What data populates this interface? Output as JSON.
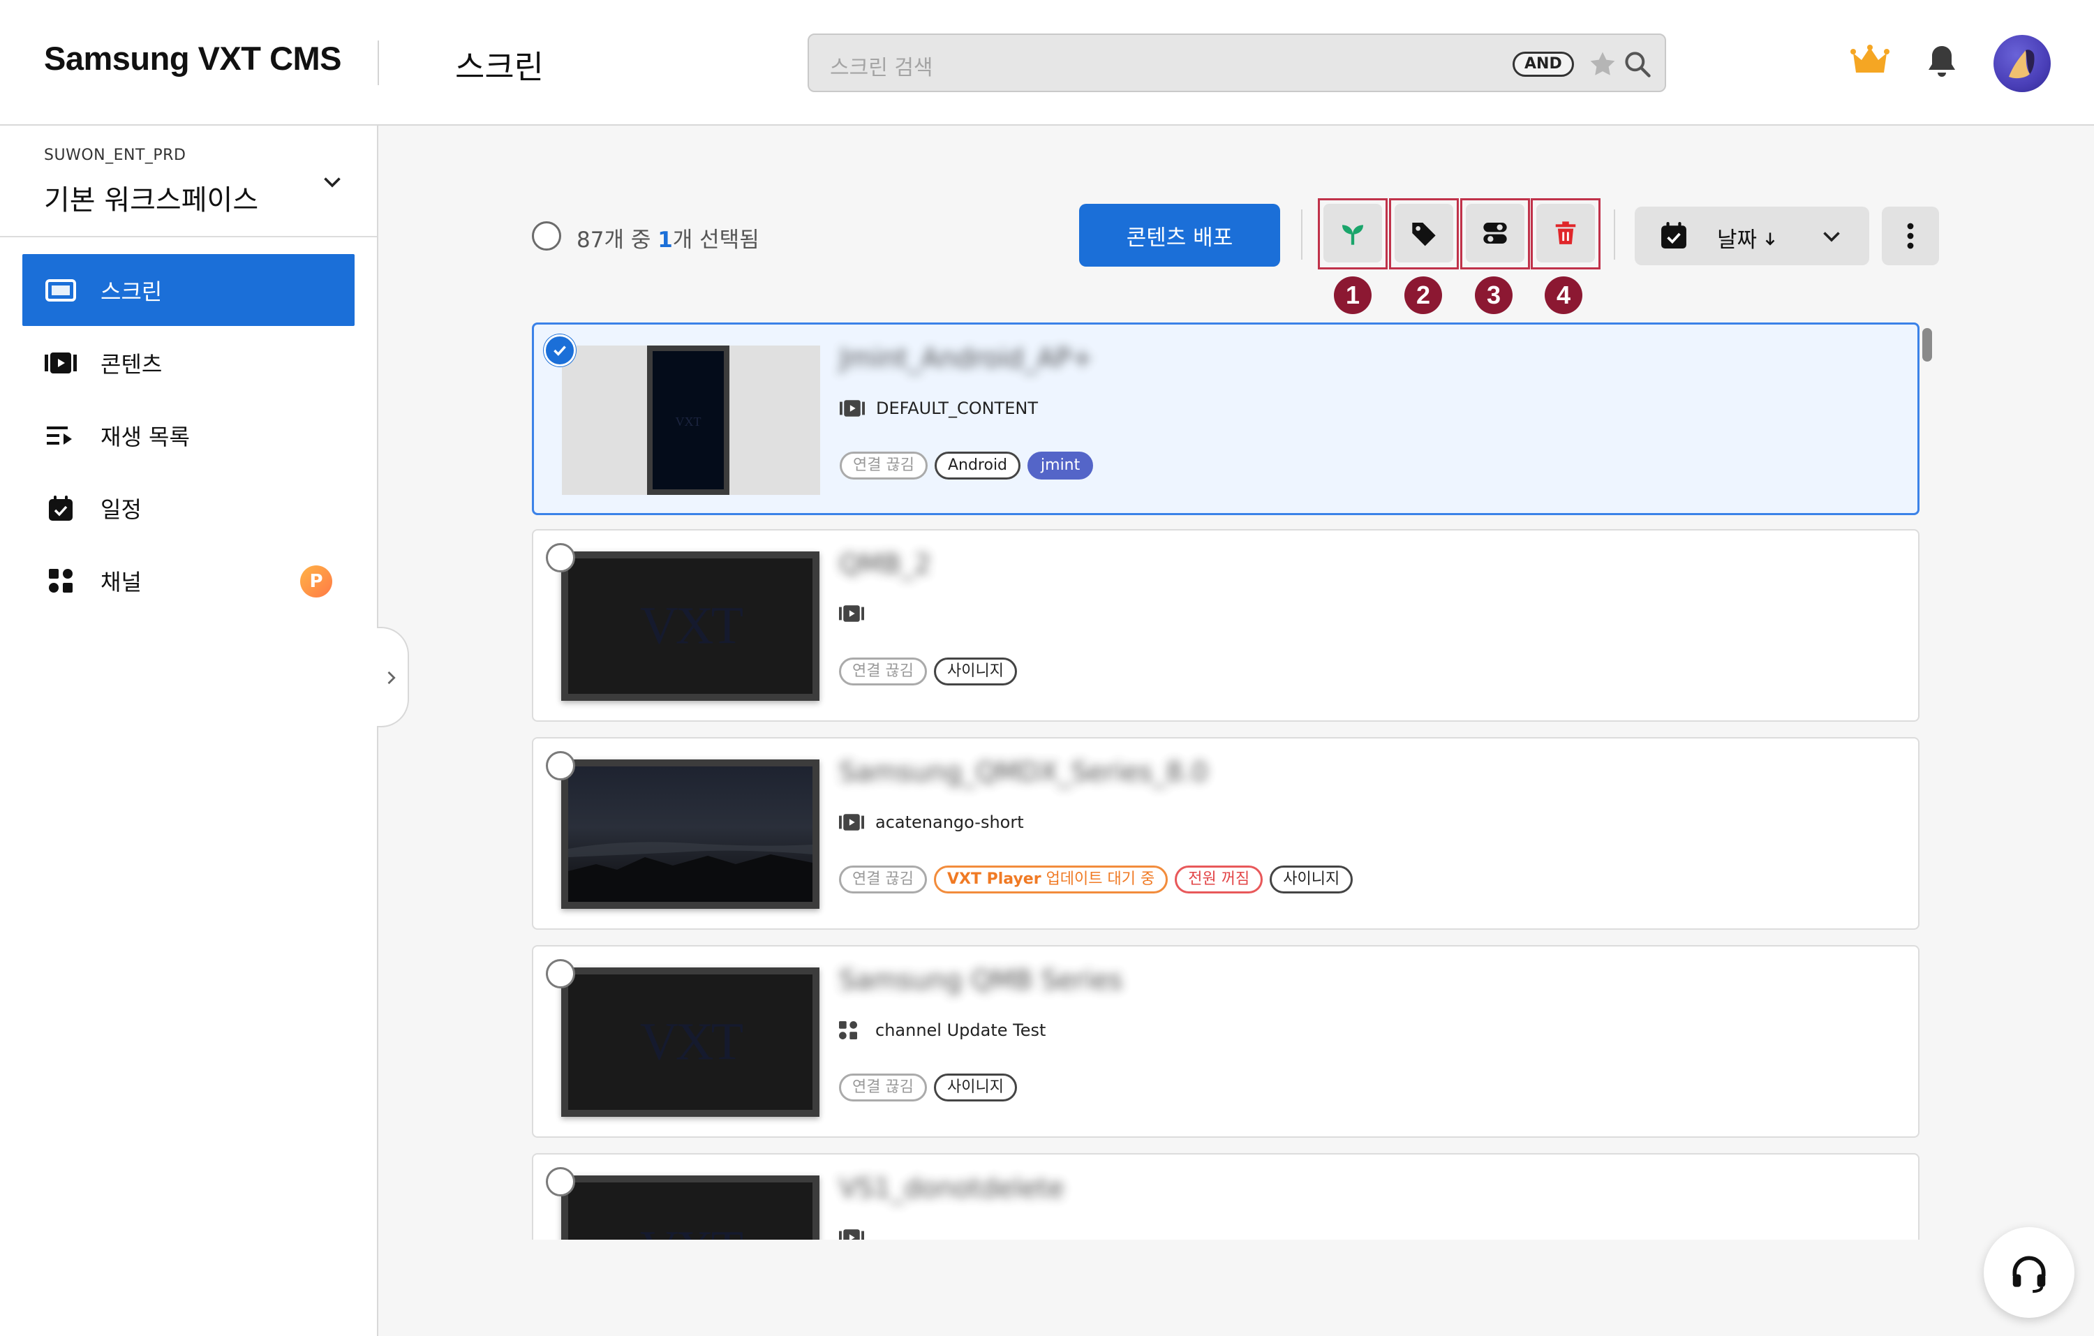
{
  "header": {
    "brand": "Samsung VXT CMS",
    "page_title": "스크린",
    "search_placeholder": "스크린 검색",
    "search_mode_badge": "AND"
  },
  "sidebar": {
    "workspace_org": "SUWON_ENT_PRD",
    "workspace_name": "기본 워크스페이스",
    "items": [
      {
        "label": "스크린",
        "icon": "screen-icon",
        "active": true
      },
      {
        "label": "콘텐츠",
        "icon": "content-icon",
        "active": false
      },
      {
        "label": "재생 목록",
        "icon": "playlist-icon",
        "active": false
      },
      {
        "label": "일정",
        "icon": "calendar-icon",
        "active": false
      },
      {
        "label": "채널",
        "icon": "channel-icon",
        "active": false,
        "badge": "P"
      }
    ]
  },
  "toolbar": {
    "selection_prefix": "87개 중 ",
    "selection_count": "1",
    "selection_suffix": "개 선택됨",
    "deploy_button": "콘텐츠 배포",
    "markers": [
      "1",
      "2",
      "3",
      "4"
    ],
    "sort_label": "날짜",
    "sort_direction_icon": "arrow-down-icon",
    "colors": {
      "accent": "#1b6fd8",
      "marker": "#8c1832",
      "highlight_border": "#c0324a",
      "seedling": "#1aa56b",
      "trash": "#e0262a"
    }
  },
  "screens": [
    {
      "title": "Jmint_Android_AP+",
      "meta_icon": "content-icon",
      "meta_text": "DEFAULT_CONTENT",
      "selected": true,
      "tags": [
        {
          "text": "연결 끊김",
          "style": "muted"
        },
        {
          "text": "Android",
          "style": "dark"
        },
        {
          "text": "jmint",
          "style": "purple"
        }
      ]
    },
    {
      "title": "QMB_2",
      "meta_icon": "content-icon",
      "meta_text": "",
      "selected": false,
      "tags": [
        {
          "text": "연결 끊김",
          "style": "muted"
        },
        {
          "text": "사이니지",
          "style": "dark"
        }
      ]
    },
    {
      "title": "Samsung_QMDX_Series_8.0",
      "meta_icon": "content-icon",
      "meta_text": "acatenango-short",
      "selected": false,
      "tags": [
        {
          "text": "연결 끊김",
          "style": "muted"
        },
        {
          "text_bold": "VXT Player",
          "text": " 업데이트 대기 중",
          "style": "orange"
        },
        {
          "text": "전원 꺼짐",
          "style": "red"
        },
        {
          "text": "사이니지",
          "style": "dark"
        }
      ]
    },
    {
      "title": "Samsung QMB Series",
      "meta_icon": "channel-icon",
      "meta_text": "channel Update Test",
      "selected": false,
      "tags": [
        {
          "text": "연결 끊김",
          "style": "muted"
        },
        {
          "text": "사이니지",
          "style": "dark"
        }
      ]
    },
    {
      "title": "VS1_donotdelete",
      "meta_icon": "content-icon",
      "meta_text": "",
      "selected": false,
      "tags": []
    }
  ],
  "thumb_text": "VXT"
}
